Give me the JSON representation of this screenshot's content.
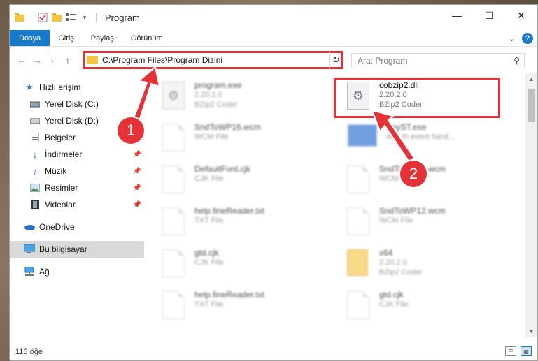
{
  "window": {
    "title": "Program"
  },
  "ribbon": {
    "tabs": [
      "Dosya",
      "Giriş",
      "Paylaş",
      "Görünüm"
    ]
  },
  "nav": {
    "address_path": "C:\\Program Files\\Program Dizini",
    "search_placeholder": "Ara: Program"
  },
  "sidebar": {
    "items": [
      {
        "label": "Hızlı erişim",
        "icon": "star-icon",
        "pinned": false
      },
      {
        "label": "Yerel Disk (C:)",
        "icon": "drive-icon",
        "pinned": false
      },
      {
        "label": "Yerel Disk (D:)",
        "icon": "drive-icon",
        "pinned": false
      },
      {
        "label": "Belgeler",
        "icon": "documents-icon",
        "pinned": false
      },
      {
        "label": "İndirmeler",
        "icon": "download-icon",
        "pinned": true
      },
      {
        "label": "Müzik",
        "icon": "music-icon",
        "pinned": true
      },
      {
        "label": "Resimler",
        "icon": "pictures-icon",
        "pinned": true
      },
      {
        "label": "Videolar",
        "icon": "videos-icon",
        "pinned": true
      },
      {
        "label": "OneDrive",
        "icon": "cloud-icon"
      },
      {
        "label": "Bu bilgisayar",
        "icon": "computer-icon"
      },
      {
        "label": "Ağ",
        "icon": "network-icon"
      }
    ]
  },
  "files": [
    {
      "name": "program.exe",
      "line2": "2.20.2.0",
      "line3": "BZip2 Coder"
    },
    {
      "name": "cobzip2.dll",
      "line2": "2.20.2.0",
      "line3": "BZip2 Coder"
    },
    {
      "name": "SndToWP16.wcm",
      "line2": "WCM File",
      "line3": ""
    },
    {
      "name": "KeyST.exe",
      "line2": "Add th event hand...",
      "line3": ""
    },
    {
      "name": "DefaultFont.cjk",
      "line2": "CJK File",
      "line3": ""
    },
    {
      "name": "SndToWP12.wcm",
      "line2": "WCM File",
      "line3": ""
    },
    {
      "name": "help.fineReader.txt",
      "line2": "TXT File",
      "line3": ""
    },
    {
      "name": "SndToWP12.wcm",
      "line2": "WCM File",
      "line3": ""
    },
    {
      "name": "gtd.cjk",
      "line2": "CJK File",
      "line3": ""
    },
    {
      "name": "x64",
      "line2": "2.20.2.0",
      "line3": "BZip2 Coder"
    },
    {
      "name": "help.fineReader.txt",
      "line2": "TXT File",
      "line3": ""
    },
    {
      "name": "gtd.cjk",
      "line2": "CJK File",
      "line3": ""
    }
  ],
  "status": {
    "item_count": "116 öğe"
  },
  "callouts": {
    "one": "1",
    "two": "2"
  },
  "colors": {
    "accent": "#1979ca",
    "highlight": "#e53238",
    "folder": "#f4c545"
  }
}
